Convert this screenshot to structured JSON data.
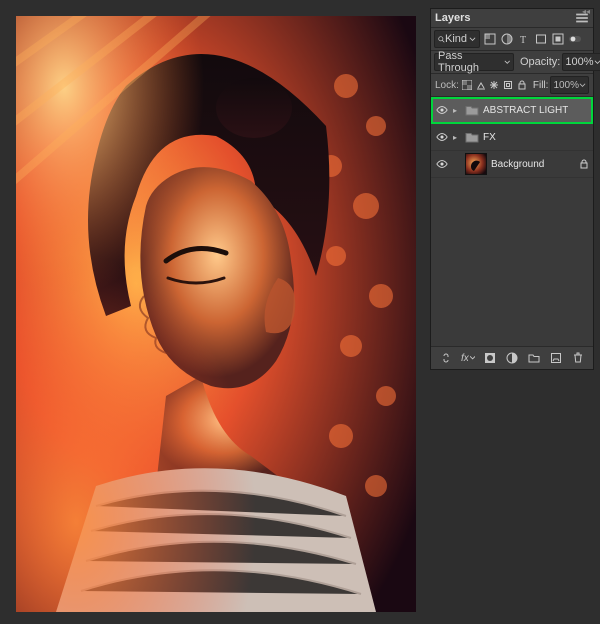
{
  "panel": {
    "title": "Layers",
    "filter_label": "Kind",
    "blend_mode": "Pass Through",
    "opacity_label": "Opacity:",
    "opacity_value": "100%",
    "lock_label": "Lock:",
    "fill_label": "Fill:",
    "fill_value": "100%"
  },
  "layers": [
    {
      "name": "ABSTRACT LIGHT",
      "type": "folder",
      "visible": true,
      "expandable": true,
      "selected": true,
      "highlighted": true,
      "locked": false
    },
    {
      "name": "FX",
      "type": "folder",
      "visible": true,
      "expandable": true,
      "selected": false,
      "highlighted": false,
      "locked": false
    },
    {
      "name": "Background",
      "type": "image",
      "visible": true,
      "expandable": false,
      "selected": false,
      "highlighted": false,
      "locked": true
    }
  ],
  "bottom_bar_fx_label": "fx"
}
